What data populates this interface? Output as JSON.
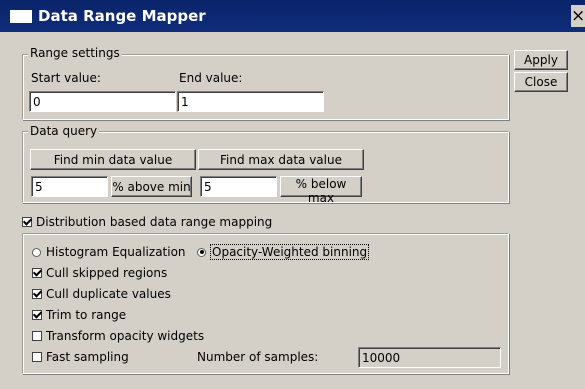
{
  "window": {
    "title": "Data Range Mapper",
    "close_glyph": "×"
  },
  "side_buttons": {
    "apply": "Apply",
    "close": "Close"
  },
  "range_settings": {
    "legend": "Range settings",
    "start_label": "Start value:",
    "start_value": "0",
    "end_label": "End value:",
    "end_value": "1"
  },
  "data_query": {
    "legend": "Data query",
    "find_min": "Find min data value",
    "find_max": "Find max data value",
    "min_percent": "5",
    "above_min": "% above min",
    "max_percent": "5",
    "below_max": "% below max"
  },
  "distribution": {
    "toggle_label": "Distribution based data range mapping",
    "toggle_checked": true,
    "histogram_eq": "Histogram Equalization",
    "histogram_eq_selected": false,
    "opacity_binning": "Opacity-Weighted binning",
    "opacity_binning_selected": true,
    "cull_skipped": "Cull skipped regions",
    "cull_skipped_checked": true,
    "cull_duplicate": "Cull duplicate values",
    "cull_duplicate_checked": true,
    "trim_range": "Trim to range",
    "trim_range_checked": true,
    "transform_opacity": "Transform opacity widgets",
    "transform_opacity_checked": false,
    "fast_sampling": "Fast sampling",
    "fast_sampling_checked": false,
    "num_samples_label": "Number of samples:",
    "num_samples_value": "10000"
  },
  "icons": {
    "window": "window-app-icon",
    "close": "close-icon"
  },
  "colors": {
    "titlebar": "#0a246a",
    "face": "#d4d0c8"
  }
}
